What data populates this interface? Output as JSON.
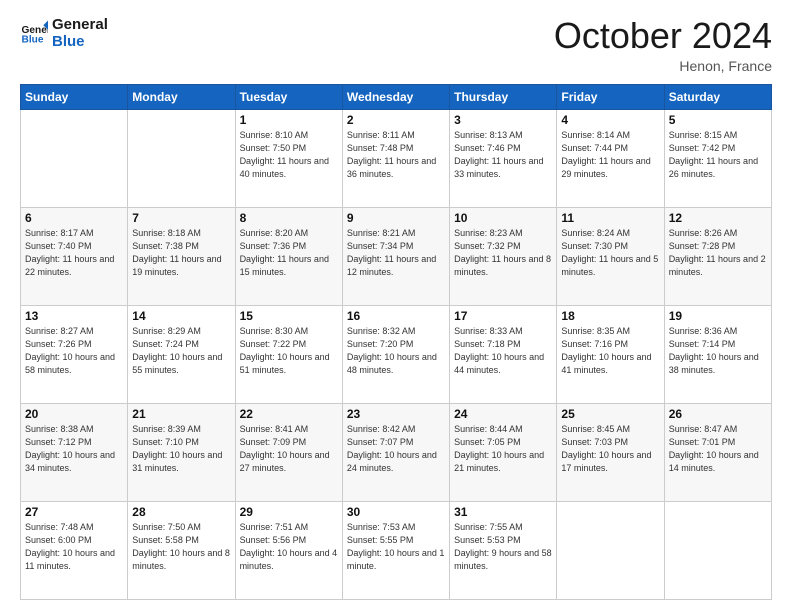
{
  "header": {
    "logo_general": "General",
    "logo_blue": "Blue",
    "month_title": "October 2024",
    "location": "Henon, France"
  },
  "days_of_week": [
    "Sunday",
    "Monday",
    "Tuesday",
    "Wednesday",
    "Thursday",
    "Friday",
    "Saturday"
  ],
  "weeks": [
    [
      {
        "day": "",
        "info": ""
      },
      {
        "day": "",
        "info": ""
      },
      {
        "day": "1",
        "info": "Sunrise: 8:10 AM\nSunset: 7:50 PM\nDaylight: 11 hours and 40 minutes."
      },
      {
        "day": "2",
        "info": "Sunrise: 8:11 AM\nSunset: 7:48 PM\nDaylight: 11 hours and 36 minutes."
      },
      {
        "day": "3",
        "info": "Sunrise: 8:13 AM\nSunset: 7:46 PM\nDaylight: 11 hours and 33 minutes."
      },
      {
        "day": "4",
        "info": "Sunrise: 8:14 AM\nSunset: 7:44 PM\nDaylight: 11 hours and 29 minutes."
      },
      {
        "day": "5",
        "info": "Sunrise: 8:15 AM\nSunset: 7:42 PM\nDaylight: 11 hours and 26 minutes."
      }
    ],
    [
      {
        "day": "6",
        "info": "Sunrise: 8:17 AM\nSunset: 7:40 PM\nDaylight: 11 hours and 22 minutes."
      },
      {
        "day": "7",
        "info": "Sunrise: 8:18 AM\nSunset: 7:38 PM\nDaylight: 11 hours and 19 minutes."
      },
      {
        "day": "8",
        "info": "Sunrise: 8:20 AM\nSunset: 7:36 PM\nDaylight: 11 hours and 15 minutes."
      },
      {
        "day": "9",
        "info": "Sunrise: 8:21 AM\nSunset: 7:34 PM\nDaylight: 11 hours and 12 minutes."
      },
      {
        "day": "10",
        "info": "Sunrise: 8:23 AM\nSunset: 7:32 PM\nDaylight: 11 hours and 8 minutes."
      },
      {
        "day": "11",
        "info": "Sunrise: 8:24 AM\nSunset: 7:30 PM\nDaylight: 11 hours and 5 minutes."
      },
      {
        "day": "12",
        "info": "Sunrise: 8:26 AM\nSunset: 7:28 PM\nDaylight: 11 hours and 2 minutes."
      }
    ],
    [
      {
        "day": "13",
        "info": "Sunrise: 8:27 AM\nSunset: 7:26 PM\nDaylight: 10 hours and 58 minutes."
      },
      {
        "day": "14",
        "info": "Sunrise: 8:29 AM\nSunset: 7:24 PM\nDaylight: 10 hours and 55 minutes."
      },
      {
        "day": "15",
        "info": "Sunrise: 8:30 AM\nSunset: 7:22 PM\nDaylight: 10 hours and 51 minutes."
      },
      {
        "day": "16",
        "info": "Sunrise: 8:32 AM\nSunset: 7:20 PM\nDaylight: 10 hours and 48 minutes."
      },
      {
        "day": "17",
        "info": "Sunrise: 8:33 AM\nSunset: 7:18 PM\nDaylight: 10 hours and 44 minutes."
      },
      {
        "day": "18",
        "info": "Sunrise: 8:35 AM\nSunset: 7:16 PM\nDaylight: 10 hours and 41 minutes."
      },
      {
        "day": "19",
        "info": "Sunrise: 8:36 AM\nSunset: 7:14 PM\nDaylight: 10 hours and 38 minutes."
      }
    ],
    [
      {
        "day": "20",
        "info": "Sunrise: 8:38 AM\nSunset: 7:12 PM\nDaylight: 10 hours and 34 minutes."
      },
      {
        "day": "21",
        "info": "Sunrise: 8:39 AM\nSunset: 7:10 PM\nDaylight: 10 hours and 31 minutes."
      },
      {
        "day": "22",
        "info": "Sunrise: 8:41 AM\nSunset: 7:09 PM\nDaylight: 10 hours and 27 minutes."
      },
      {
        "day": "23",
        "info": "Sunrise: 8:42 AM\nSunset: 7:07 PM\nDaylight: 10 hours and 24 minutes."
      },
      {
        "day": "24",
        "info": "Sunrise: 8:44 AM\nSunset: 7:05 PM\nDaylight: 10 hours and 21 minutes."
      },
      {
        "day": "25",
        "info": "Sunrise: 8:45 AM\nSunset: 7:03 PM\nDaylight: 10 hours and 17 minutes."
      },
      {
        "day": "26",
        "info": "Sunrise: 8:47 AM\nSunset: 7:01 PM\nDaylight: 10 hours and 14 minutes."
      }
    ],
    [
      {
        "day": "27",
        "info": "Sunrise: 7:48 AM\nSunset: 6:00 PM\nDaylight: 10 hours and 11 minutes."
      },
      {
        "day": "28",
        "info": "Sunrise: 7:50 AM\nSunset: 5:58 PM\nDaylight: 10 hours and 8 minutes."
      },
      {
        "day": "29",
        "info": "Sunrise: 7:51 AM\nSunset: 5:56 PM\nDaylight: 10 hours and 4 minutes."
      },
      {
        "day": "30",
        "info": "Sunrise: 7:53 AM\nSunset: 5:55 PM\nDaylight: 10 hours and 1 minute."
      },
      {
        "day": "31",
        "info": "Sunrise: 7:55 AM\nSunset: 5:53 PM\nDaylight: 9 hours and 58 minutes."
      },
      {
        "day": "",
        "info": ""
      },
      {
        "day": "",
        "info": ""
      }
    ]
  ]
}
